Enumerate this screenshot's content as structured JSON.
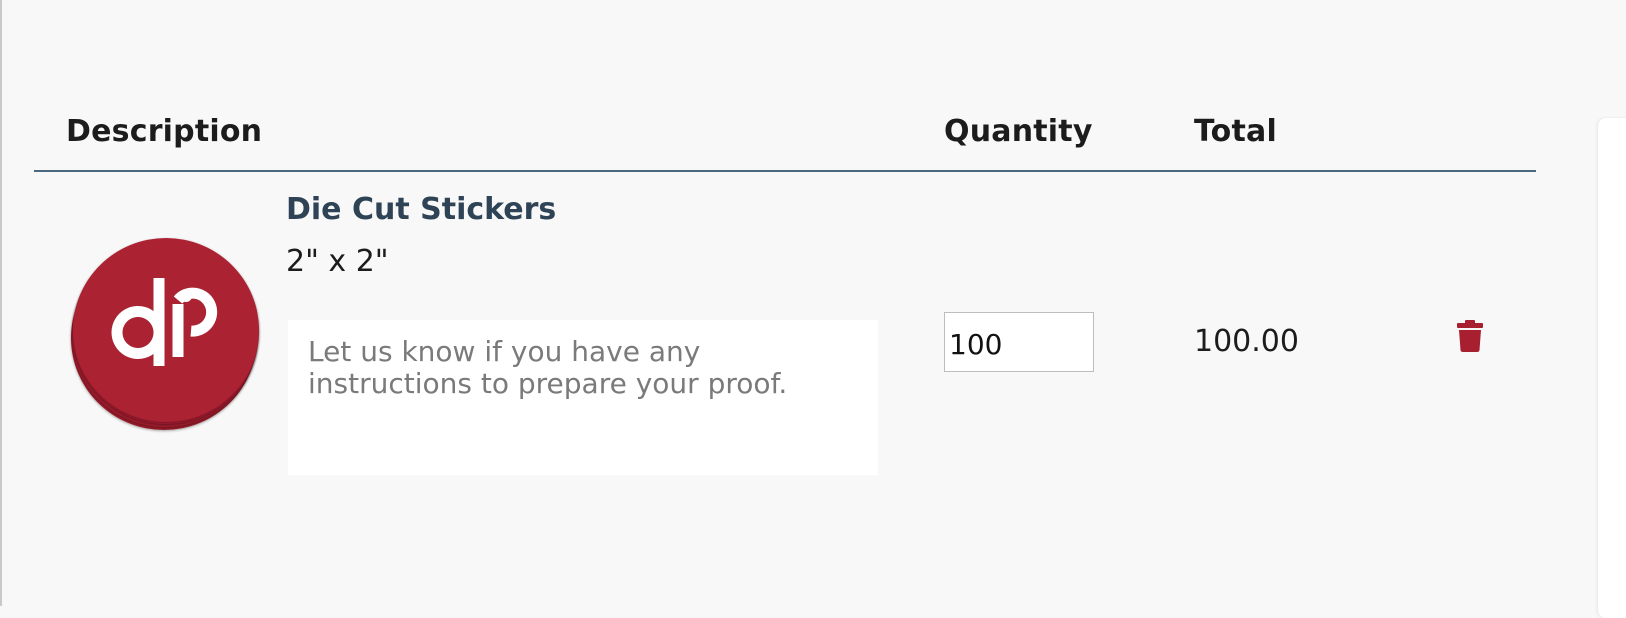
{
  "colors": {
    "brand_red": "#a81f30",
    "header_rule": "#4b6a80",
    "product_name": "#2e4356"
  },
  "table": {
    "headers": {
      "description": "Description",
      "quantity": "Quantity",
      "total": "Total"
    }
  },
  "item": {
    "name": "Die Cut Stickers",
    "size": "2\" x 2\"",
    "notes_placeholder": "Let us know if you have any instructions to prepare your proof.",
    "quantity": "100",
    "total": "100.00",
    "thumbnail_icon": "sticker-stack-logo-icon",
    "delete_icon": "trash-icon"
  }
}
